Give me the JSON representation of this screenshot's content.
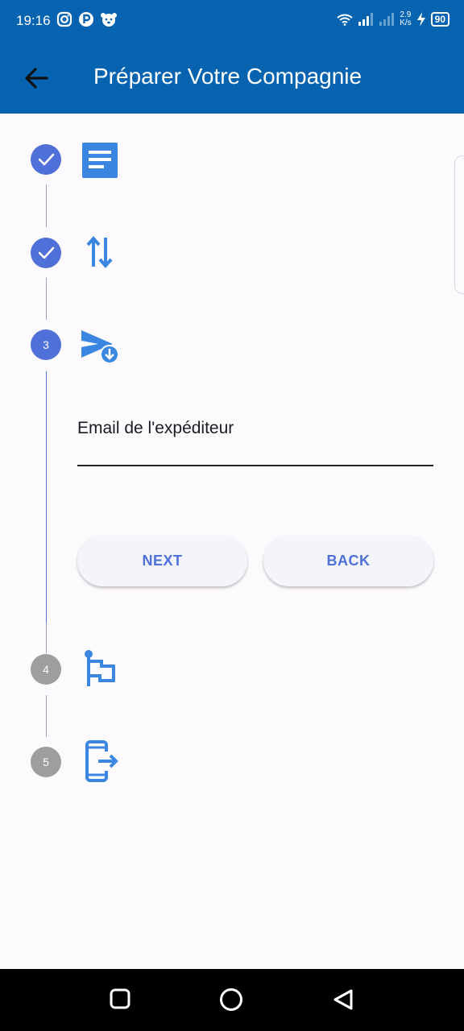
{
  "status_bar": {
    "time": "19:16",
    "net_speed_value": "2.9",
    "net_speed_unit": "K/s",
    "battery": "90",
    "left_icons": [
      "instagram-icon",
      "p-app-icon",
      "dog-app-icon"
    ],
    "right_icons": [
      "wifi-icon",
      "signal-icon",
      "signal-icon",
      "charging-icon"
    ]
  },
  "app_bar": {
    "title": "Préparer Votre Compagnie",
    "background": "#0563b0"
  },
  "stepper": {
    "accent": "#4f6fd9",
    "inactive_color": "#9e9e9e",
    "icon_color": "#3a86e0",
    "steps": [
      {
        "state": "complete",
        "label": "",
        "icon": "document-icon"
      },
      {
        "state": "complete",
        "label": "",
        "icon": "swap-vertical-icon"
      },
      {
        "state": "active",
        "label": "3",
        "icon": "send-download-icon"
      },
      {
        "state": "pending",
        "label": "4",
        "icon": "flag-icon"
      },
      {
        "state": "pending",
        "label": "5",
        "icon": "exit-device-icon"
      }
    ]
  },
  "form": {
    "email_label": "Email de l'expéditeur",
    "email_value": "",
    "next_label": "NEXT",
    "back_label": "BACK"
  }
}
